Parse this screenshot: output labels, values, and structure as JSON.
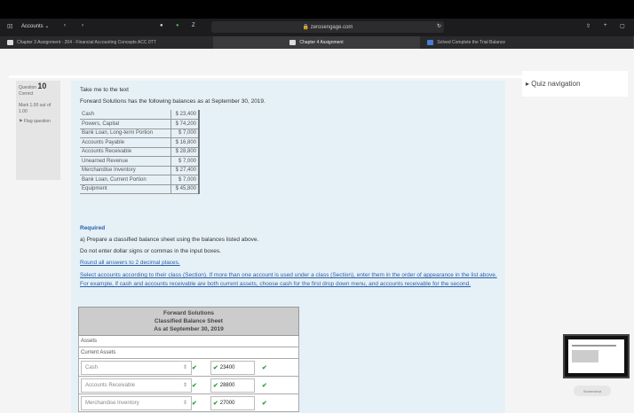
{
  "browser": {
    "accounts_label": "Accounts",
    "url": "zerosengage.com",
    "tabs": [
      "Chapter 3 Assignment - 204 - Financial Accounting Concepts ACC 0TT",
      "Chapter 4 Assignment",
      "Solved Complete the Trial Balance"
    ]
  },
  "question": {
    "label": "Question",
    "number": "10",
    "status": "Correct",
    "mark": "Mark 1.00 out of 1.00",
    "flag": "Flag question"
  },
  "content": {
    "intro": "Take me to the text",
    "prompt": "Forward Solutions has the following balances as at September 30, 2019.",
    "balances": [
      {
        "label": "Cash",
        "value": "$ 23,400"
      },
      {
        "label": "Powers, Capital",
        "value": "$ 74,200"
      },
      {
        "label": "Bank Loan, Long-term Portion",
        "value": "$ 7,000"
      },
      {
        "label": "Accounts Payable",
        "value": "$ 16,800"
      },
      {
        "label": "Accounts Receivable",
        "value": "$ 28,800"
      },
      {
        "label": "Unearned Revenue",
        "value": "$ 7,000"
      },
      {
        "label": "Merchandise Inventory",
        "value": "$ 27,400"
      },
      {
        "label": "Bank Loan, Current Portion",
        "value": "$ 7,000"
      },
      {
        "label": "Equipment",
        "value": "$ 45,800"
      }
    ],
    "required_heading": "Required",
    "req_a": "a) Prepare a classified balance sheet using the balances listed above.",
    "req_note1": "Do not enter dollar signs or commas in the input boxes.",
    "req_note2": "Round all answers to 2 decimal places.",
    "req_note3": "Select accounts according to their class (Section). If more than one account is used under a class (Section), enter them in the order of appearance in the list above. For example, if cash and accounts receivable are both current assets, choose cash for the first drop down menu, and accounts receivable for the second.",
    "bs": {
      "company": "Forward Solutions",
      "title": "Classified Balance Sheet",
      "date": "As at September 30, 2019",
      "assets": "Assets",
      "current_assets": "Current Assets",
      "rows": [
        {
          "account": "Cash",
          "amount": "23400"
        },
        {
          "account": "Accounts Receivable",
          "amount": "28800"
        },
        {
          "account": "Merchandise Inventory",
          "amount": "27000"
        }
      ]
    }
  },
  "quiz_navigation": "Quiz navigation",
  "thumbnail_button": "Screenshot"
}
